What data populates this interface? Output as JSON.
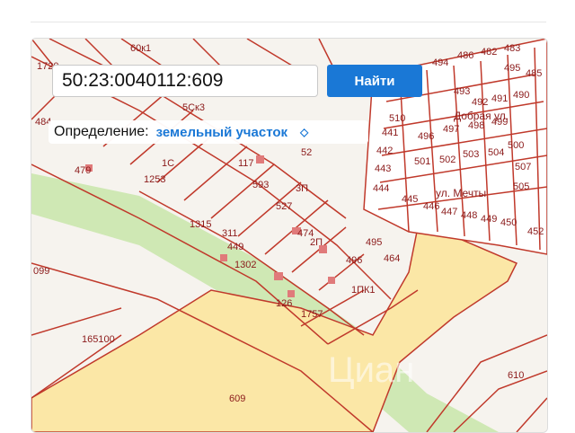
{
  "search": {
    "value": "50:23:0040112:609",
    "button_label": "Найти"
  },
  "definition": {
    "label": "Определение:",
    "selected": "земельный участок"
  },
  "map": {
    "street_labels": [
      "ул. Мечты",
      "Добрая ул."
    ],
    "parcel_labels": [
      "60к1",
      "5Ск3",
      "1С",
      "479",
      "1253",
      "117",
      "593",
      "52",
      "527",
      "3П",
      "1315",
      "311",
      "449",
      "1302",
      "474",
      "2П",
      "495",
      "464",
      "496",
      "1ПК1",
      "126",
      "1757",
      "165100",
      "099",
      "609",
      "610",
      "510",
      "496",
      "497",
      "498",
      "499",
      "500",
      "501",
      "502",
      "503",
      "504",
      "505",
      "507",
      "441",
      "442",
      "443",
      "444",
      "445",
      "446",
      "447",
      "448",
      "449",
      "450",
      "452",
      "490",
      "491",
      "492",
      "493",
      "494",
      "495",
      "485",
      "486",
      "482",
      "483",
      "484",
      "1720",
      "7"
    ],
    "watermark": "Циан",
    "colors": {
      "parcel_line": "#c0392b",
      "highlight_fill": "#fbe7a6",
      "road_green": "#cfe8b4",
      "building": "#e07a7a"
    }
  }
}
